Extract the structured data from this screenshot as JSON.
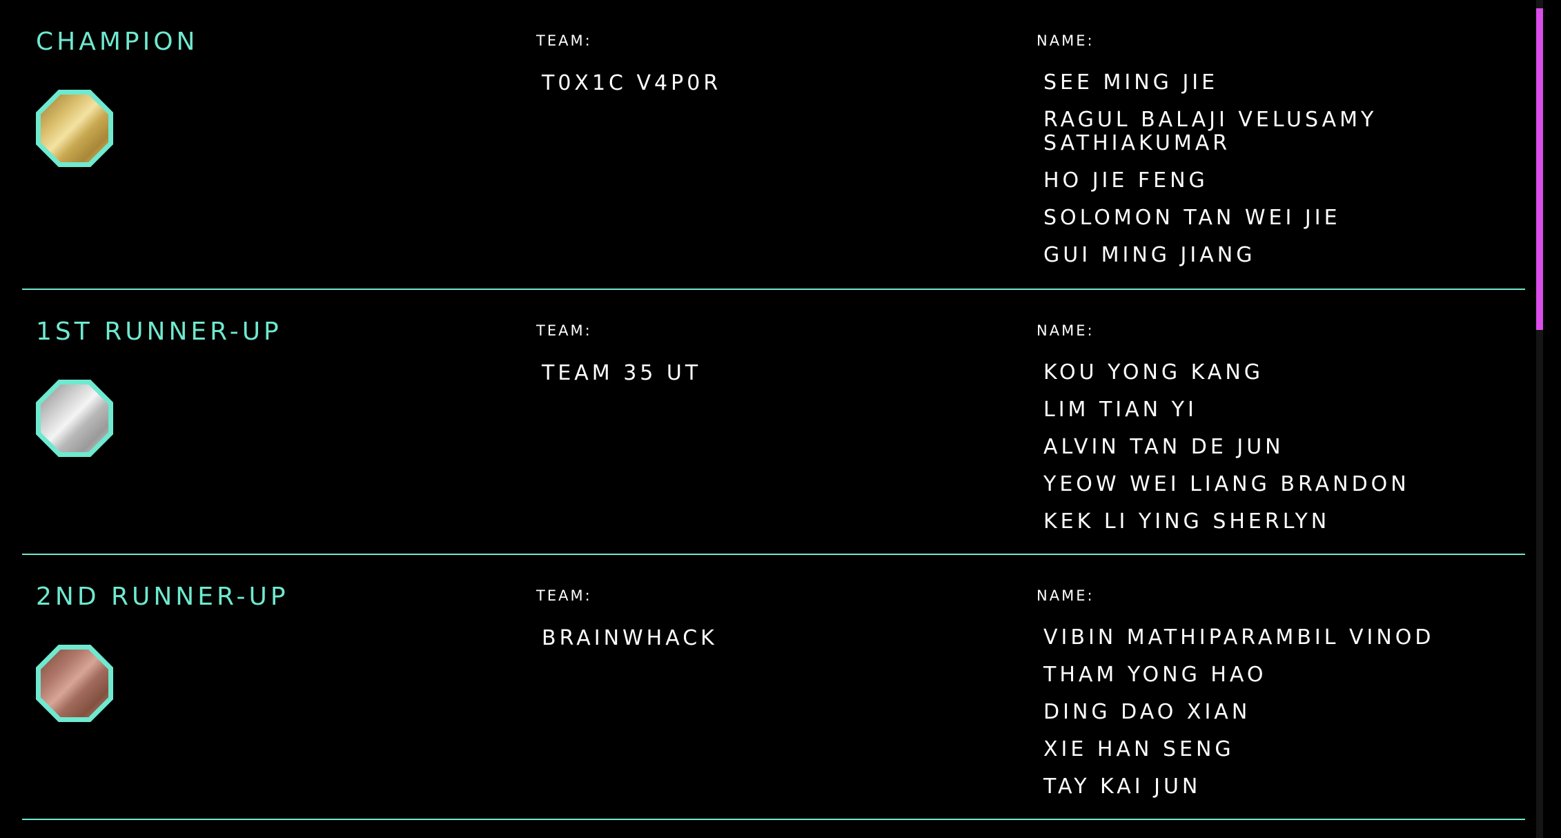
{
  "colors": {
    "accent": "#6fe9cf",
    "background": "#000000",
    "text": "#ffffff",
    "scrollbar_thumb": "#d94de8"
  },
  "team_label": "TEAM:",
  "name_label": "NAME:",
  "awards": [
    {
      "title": "CHAMPION",
      "medal": "gold-medal-icon",
      "team": "T0X1C V4P0R",
      "members": [
        "SEE MING JIE",
        "RAGUL BALAJI VELUSAMY SATHIAKUMAR",
        "HO JIE FENG",
        "SOLOMON TAN WEI JIE",
        "GUI MING JIANG"
      ]
    },
    {
      "title": "1ST RUNNER-UP",
      "medal": "silver-medal-icon",
      "team": "TEAM 35 UT",
      "members": [
        "KOU YONG KANG",
        "LIM TIAN YI",
        "ALVIN TAN DE JUN",
        "YEOW WEI LIANG BRANDON",
        "KEK LI YING SHERLYN"
      ]
    },
    {
      "title": "2ND RUNNER-UP",
      "medal": "bronze-medal-icon",
      "team": "BRAINWHACK",
      "members": [
        "VIBIN MATHIPARAMBIL VINOD",
        "THAM YONG HAO",
        "DING DAO XIAN",
        "XIE HAN SENG",
        "TAY KAI JUN"
      ]
    }
  ]
}
